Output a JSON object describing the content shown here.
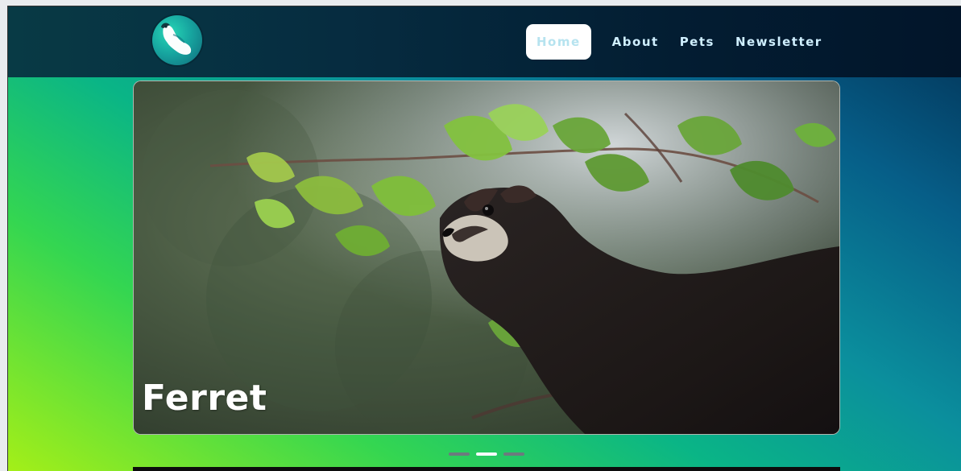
{
  "nav": {
    "logo_alt": "Ferret logo",
    "items": [
      {
        "label": "Home",
        "active": true
      },
      {
        "label": "About",
        "active": false
      },
      {
        "label": "Pets",
        "active": false
      },
      {
        "label": "Newsletter",
        "active": false
      }
    ]
  },
  "carousel": {
    "caption": "Ferret",
    "indicators": [
      {
        "active": false
      },
      {
        "active": true
      },
      {
        "active": false
      }
    ]
  },
  "colors": {
    "nav_bg": "#062c40",
    "active_nav_bg": "#ffffff",
    "gradient_start": "#a4ef18",
    "gradient_end": "#032f52"
  },
  "icons": {
    "logo": "ferret-logo-icon"
  }
}
